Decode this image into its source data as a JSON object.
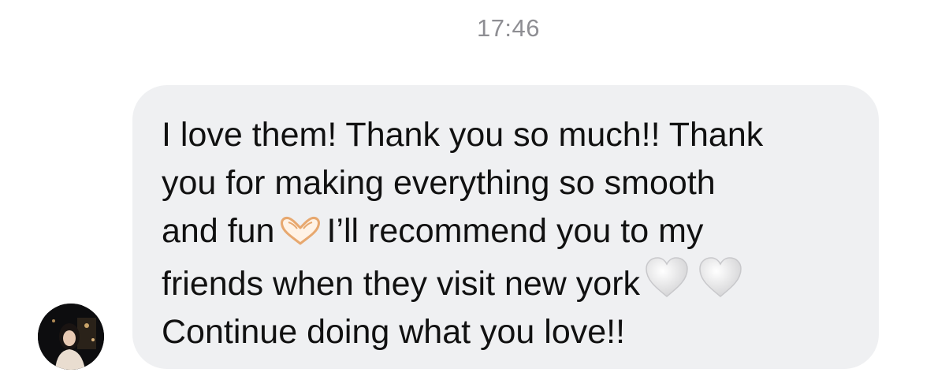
{
  "chat": {
    "timestamp": "17:46",
    "message": {
      "line1": "I love them! Thank you so much!! Thank",
      "line2": "you for making everything so smooth",
      "line3_before_emoji": "and fun",
      "line3_after_emoji": "I’ll recommend you to my",
      "line4_before_emoji": "friends when they visit new york",
      "line5": "Continue doing what you love!!",
      "emojis": [
        "heart-hands-icon",
        "white-heart-icon",
        "white-heart-icon"
      ]
    },
    "colors": {
      "bubble": "#eff0f2",
      "text": "#111111",
      "timestamp": "#8e8e93"
    }
  }
}
